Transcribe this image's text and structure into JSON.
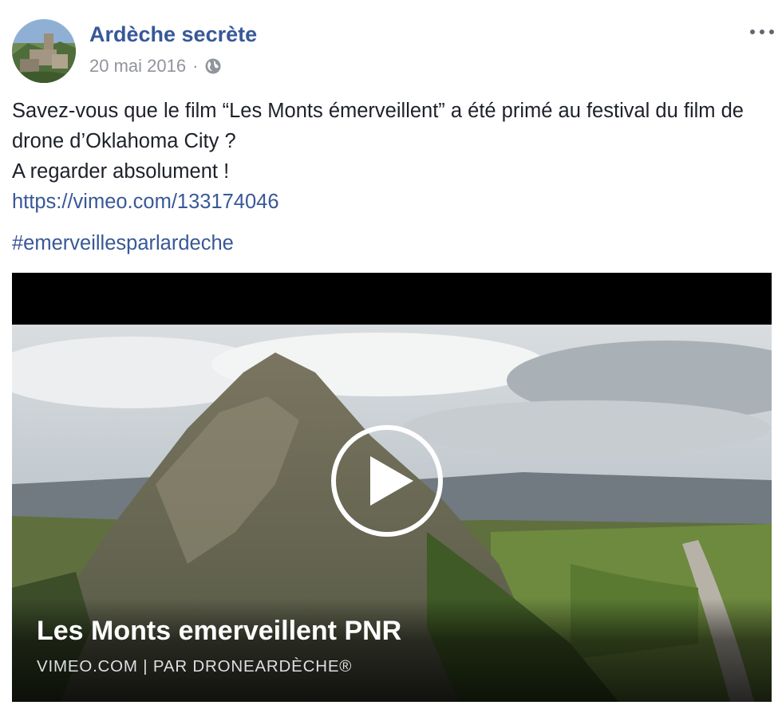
{
  "post": {
    "author": "Ardèche secrète",
    "date": "20 mai 2016",
    "separator": "·",
    "audience_icon": "globe-icon",
    "more_icon": "more-options-icon",
    "text_lines": [
      "Savez-vous que le film “Les Monts émerveillent” a été primé au festival du film de drone d’Oklahoma City ?",
      "A regarder absolument !"
    ],
    "link": "https://vimeo.com/133174046",
    "hashtag": "#emerveillesparlardeche"
  },
  "video": {
    "title": "Les Monts emerveillent PNR",
    "source": "VIMEO.COM  |  PAR DRONEARDÈCHE®",
    "play_icon": "play-icon"
  }
}
